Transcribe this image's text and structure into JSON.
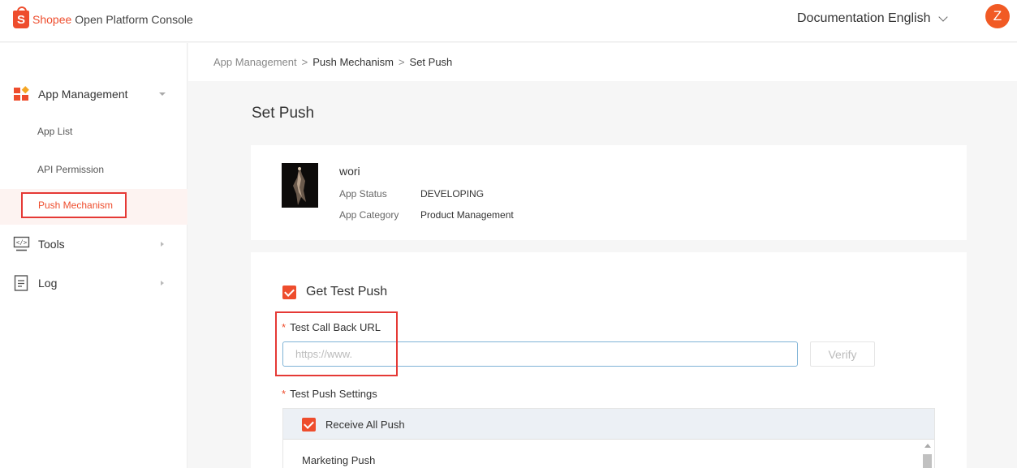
{
  "header": {
    "brand": "Shopee",
    "title": "Open Platform Console",
    "logo_letter": "S",
    "documentation": "Documentation",
    "language": "English",
    "avatar_letter": "Z"
  },
  "sidebar": {
    "groups": [
      {
        "label": "App Management",
        "icon": "app-grid-icon",
        "expanded": true,
        "items": [
          {
            "label": "App List",
            "active": false
          },
          {
            "label": "API Permission",
            "active": false
          },
          {
            "label": "Push Mechanism",
            "active": true
          }
        ]
      },
      {
        "label": "Tools",
        "icon": "code-monitor-icon",
        "expanded": false
      },
      {
        "label": "Log",
        "icon": "document-icon",
        "expanded": false
      }
    ]
  },
  "breadcrumb": [
    "App Management",
    "Push Mechanism",
    "Set Push"
  ],
  "page_title": "Set Push",
  "app": {
    "name": "wori",
    "status_label": "App Status",
    "status_value": "DEVELOPING",
    "category_label": "App Category",
    "category_value": "Product Management"
  },
  "push": {
    "get_test_push_label": "Get Test Push",
    "get_test_push_checked": true,
    "callback_label": "Test Call Back URL",
    "callback_value": "",
    "callback_placeholder": "https://www.",
    "verify_label": "Verify",
    "settings_label": "Test Push Settings",
    "receive_all_label": "Receive All Push",
    "receive_all_checked": true,
    "first_group": "Marketing Push",
    "required_mark": "*"
  },
  "colors": {
    "accent": "#ee4d2d",
    "highlight": "#e53935",
    "input_border": "#7fb3d6"
  }
}
